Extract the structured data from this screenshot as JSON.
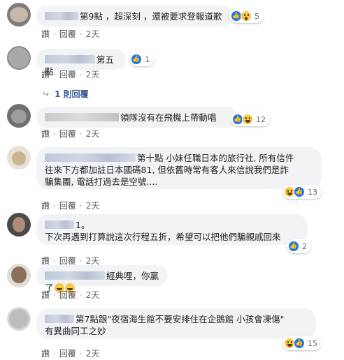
{
  "comments": [
    {
      "id": "c1",
      "text": "第9點 ，超深刻 ，還被要求登報道歉",
      "reaction_count": "5",
      "reaction_icons": [
        "like-icon",
        "wow-icon"
      ],
      "actions": {
        "like": "讚",
        "reply": "回覆",
        "time": "2天"
      }
    },
    {
      "id": "c2",
      "text": "第五點",
      "reaction_count": "1",
      "reaction_icons": [
        "like-icon"
      ],
      "actions": {
        "like": "讚",
        "reply": "回覆",
        "time": "2天"
      },
      "replies_label": "1 則回覆"
    },
    {
      "id": "c3",
      "text": "領隊沒有在飛機上帶動唱",
      "reaction_count": "12",
      "reaction_icons": [
        "like-icon",
        "haha-icon"
      ],
      "actions": {
        "like": "讚",
        "reply": "回覆",
        "time": "2天"
      }
    },
    {
      "id": "c4",
      "text_line1": "第十點 小妹任職日本的旅行社, 所有信件",
      "text_line2": "往來下方都加註日本國碼81, 但依舊時常有客人來信說我們是詐",
      "text_line3": "騙集團, 電話打過去是空號....",
      "reaction_count": "13",
      "reaction_icons": [
        "haha-icon",
        "like-icon"
      ],
      "actions": {
        "like": "讚",
        "reply": "回覆",
        "time": "2天"
      }
    },
    {
      "id": "c5",
      "text_line1": "1。",
      "text_line2": "下次再遇到打算說這次行程五折，希望可以把他們騙親戚回來",
      "reaction_count": "2",
      "reaction_icons": [
        "like-icon"
      ],
      "actions": {
        "like": "讚",
        "reply": "回覆",
        "time": "2天"
      }
    },
    {
      "id": "c6",
      "text": "經典哩，你贏了",
      "actions": {
        "like": "讚",
        "reply": "回覆",
        "time": "2天"
      }
    },
    {
      "id": "c7",
      "text_line1": "第7點跟\"夜宿海生館不要安排住在企鵝館 小孩會凍傷\"",
      "text_line2": "有異曲同工之妙",
      "reaction_count": "15",
      "reaction_icons": [
        "haha-icon",
        "like-icon"
      ],
      "actions": {
        "like": "讚",
        "reply": "回覆",
        "time": "2天"
      }
    }
  ],
  "colors": {
    "like_blue": "#1877f2",
    "bubble_bg": "#f2f3f5",
    "link_blue": "#385898"
  }
}
